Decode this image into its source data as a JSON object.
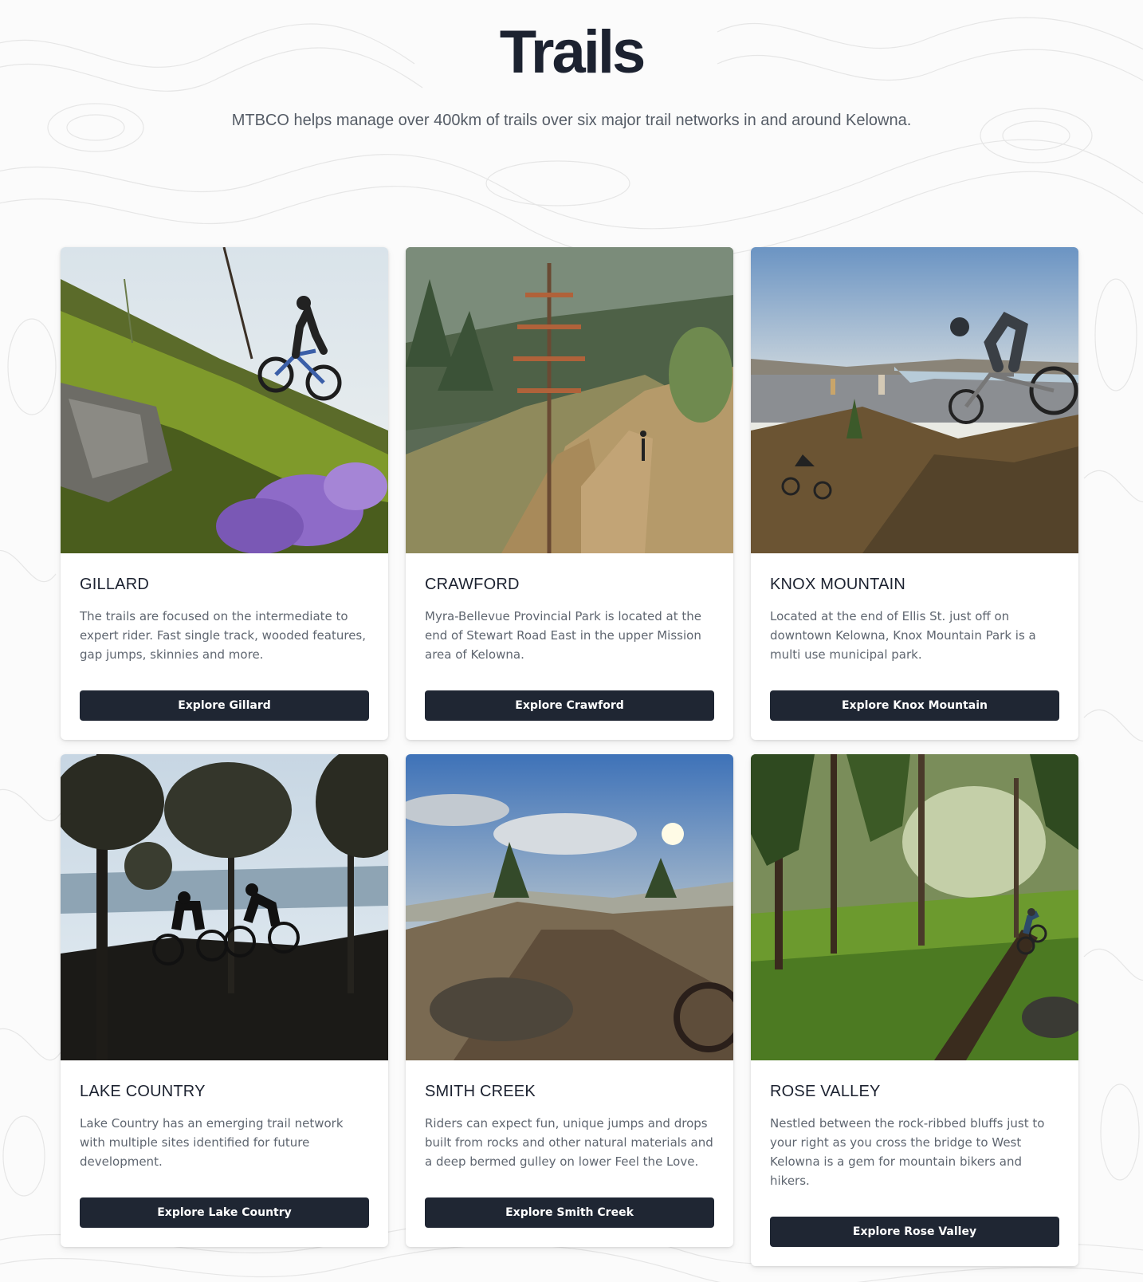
{
  "header": {
    "title": "Trails",
    "subtitle": "MTBCO helps manage over 400km of trails over six major trail networks in and around Kelowna."
  },
  "cards": [
    {
      "title": "GILLARD",
      "description": "The trails are focused on the intermediate to expert rider. Fast single track, wooded features, gap jumps, skinnies and more.",
      "button": "Explore Gillard",
      "image": "mountain-biker-hillside-purple-flowers"
    },
    {
      "title": "CRAWFORD",
      "description": "Myra-Bellevue Provincial Park is located at the end of Stewart Road East in the upper Mission area of Kelowna.",
      "button": "Explore Crawford",
      "image": "forested-valley-rider"
    },
    {
      "title": "KNOX MOUNTAIN",
      "description": "Located at the end of Ellis St. just off on downtown Kelowna, Knox Mountain Park is a multi use municipal park.",
      "button": "Explore Knox Mountain",
      "image": "bike-jump-over-city"
    },
    {
      "title": "LAKE COUNTRY",
      "description": "Lake Country has an emerging trail network with multiple sites identified for future development.",
      "button": "Explore Lake Country",
      "image": "silhouette-riders-trees-lake"
    },
    {
      "title": "SMITH CREEK",
      "description": "Riders can expect fun, unique jumps and drops built from rocks and other natural materials and a deep bermed gulley on lower Feel the Love.",
      "button": "Explore Smith Creek",
      "image": "rocky-trail-sun-clouds"
    },
    {
      "title": "ROSE VALLEY",
      "description": "Nestled between the rock-ribbed bluffs just to your right as you cross the bridge to West Kelowna is a gem for mountain bikers and hikers.",
      "button": "Explore Rose Valley",
      "image": "green-forest-rider"
    }
  ]
}
